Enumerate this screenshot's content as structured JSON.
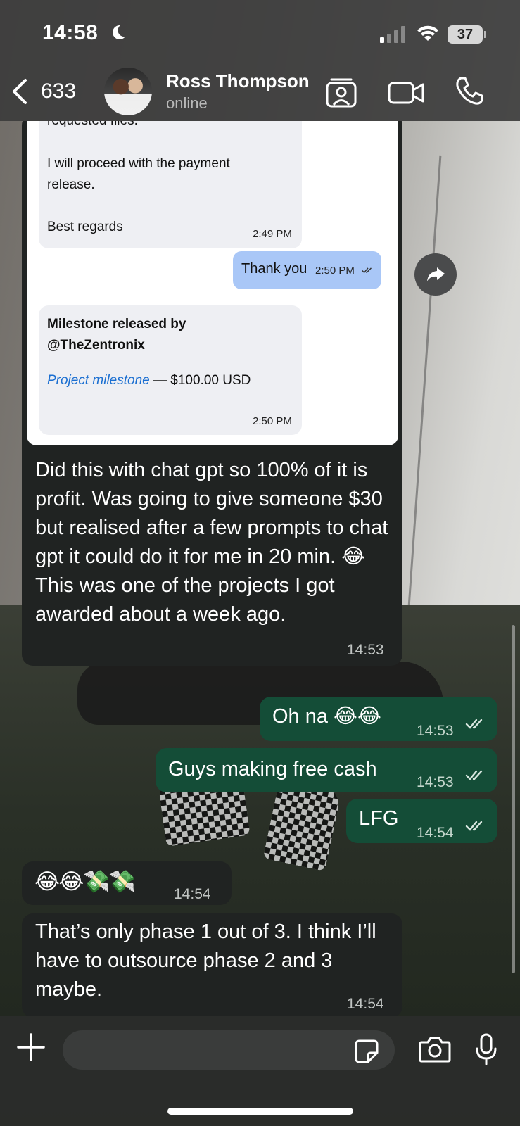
{
  "status_bar": {
    "time": "14:58",
    "battery": "37"
  },
  "header": {
    "back_count": "633",
    "contact_name": "Ross Thompson",
    "contact_status": "online"
  },
  "screenshot": {
    "partial_line": "requested files.",
    "line_proceed": "I will proceed with the payment release.",
    "regards": "Best regards",
    "regards_time": "2:49 PM",
    "thank_you": "Thank you",
    "thank_you_time": "2:50 PM",
    "milestone_title": "Milestone released by @TheZentronix",
    "milestone_link": "Project milestone",
    "milestone_amount": " — $100.00 USD",
    "milestone_time": "2:50 PM"
  },
  "messages": [
    {
      "direction": "in",
      "text": "Did this with chat gpt so 100% of it is profit. Was going to give someone $30 but realised after a few prompts to chat gpt it could do it for me in 20 min. 😂 This was one of the projects I got awarded about a week ago.",
      "time": "14:53"
    },
    {
      "direction": "out",
      "text": "Oh na 😂😂",
      "time": "14:53"
    },
    {
      "direction": "out",
      "text": "Guys making free cash",
      "time": "14:53"
    },
    {
      "direction": "out",
      "text": "LFG",
      "time": "14:54"
    },
    {
      "direction": "in",
      "text": "😂😂💸💸",
      "time": "14:54"
    },
    {
      "direction": "in",
      "text": "That’s only phase 1 out of 3. I think I’ll have to outsource phase 2 and 3 maybe.",
      "time": "14:54"
    }
  ],
  "colors": {
    "incoming_bubble": "#202322",
    "outgoing_bubble": "#144d37",
    "link": "#1b6fd1"
  },
  "icons": [
    "moon-icon",
    "signal-icon",
    "wifi-icon",
    "back-chevron-icon",
    "contact-card-icon",
    "video-call-icon",
    "phone-call-icon",
    "forward-icon",
    "read-double-check-icon",
    "plus-icon",
    "sticker-icon",
    "camera-icon",
    "microphone-icon"
  ]
}
